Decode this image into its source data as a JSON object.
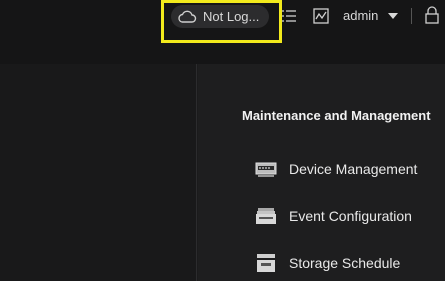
{
  "header": {
    "cloud_status": "Not Log...",
    "user": "admin",
    "icons": {
      "cloud": "cloud-icon",
      "list": "list-icon",
      "chart": "chart-icon",
      "caret": "chevron-down-icon",
      "lock": "lock-icon"
    }
  },
  "highlight_color": "#f2ea1c",
  "panel": {
    "title": "Maintenance and Management",
    "items": [
      {
        "label": "Device Management",
        "icon": "device-management-icon"
      },
      {
        "label": "Event Configuration",
        "icon": "event-configuration-icon"
      },
      {
        "label": "Storage Schedule",
        "icon": "storage-schedule-icon"
      }
    ]
  }
}
